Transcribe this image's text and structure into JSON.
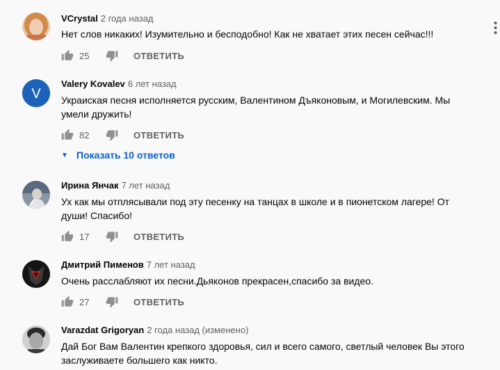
{
  "reply_label": "ОТВЕТИТЬ",
  "comments": [
    {
      "author": "VCrystal",
      "time": "2 года назад",
      "text": "Нет слов никаких! Изумительно и бесподобно! Как не хватает этих песен сейчас!!!",
      "likes": "25"
    },
    {
      "author": "Valery Kovalev",
      "time": "6 лет назад",
      "text": "Украиская песня исполняется русским, Валентином Дъяконовым, и Могилевским. Мы\n умели дружить!",
      "likes": "82",
      "avatar_letter": "V"
    },
    {
      "author": "Ирина Янчак",
      "time": "7 лет назад",
      "text": "Ух как мы отплясывали под эту песенку на танцах в школе и в пионетском лагере!  От\nдуши! Спасибо!",
      "likes": "17"
    },
    {
      "author": "Дмитрий Пименов",
      "time": "7 лет назад",
      "text": "Очень расслабляют их песни.Дьяконов прекрасен,спасибо за видео.",
      "likes": "27"
    },
    {
      "author": "Varazdat Grigoryan",
      "time": "2 года назад (изменено)",
      "text": "Дай Бог Вам Валентин  крепкого здоровья, сил и всего самого, светлый человек Вы этого\nзаслуживаете большего как никто."
    }
  ],
  "replies_toggle": {
    "label": "Показать 10 ответов"
  },
  "colors": {
    "background": "#f9f9f9",
    "link_blue": "#065fd4",
    "meta_gray": "#606060",
    "avatar_v_bg": "#1c62b9"
  },
  "icons": [
    "thumb-up-icon",
    "thumb-down-icon",
    "caret-down-icon",
    "more-vert-icon"
  ]
}
